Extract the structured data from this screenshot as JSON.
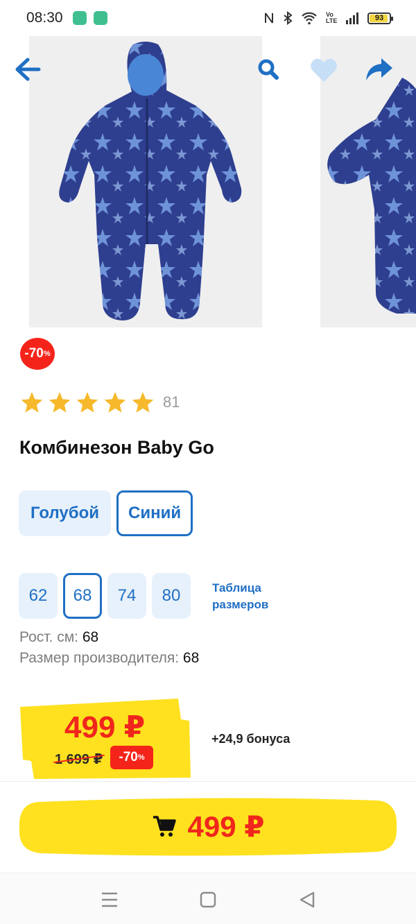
{
  "status_bar": {
    "time": "08:30",
    "battery": "93",
    "network_label": "Vo LTE"
  },
  "product": {
    "discount_badge": {
      "value": "-70",
      "unit": "%"
    },
    "rating_stars": 5,
    "rating_count": "81",
    "title": "Комбинезон Baby Go",
    "colors": [
      "Голубой",
      "Синий"
    ],
    "selected_color": "Синий",
    "sizes": [
      "62",
      "68",
      "74",
      "80"
    ],
    "selected_size": "68",
    "size_table_label": [
      "Таблица",
      "размеров"
    ],
    "height_label": "Рост. см:",
    "height_value": "68",
    "maker_size_label": "Размер производителя:",
    "maker_size_value": "68"
  },
  "price": {
    "current": "499 ₽",
    "old": "1 699 ₽",
    "discount": {
      "value": "-70",
      "unit": "%"
    },
    "bonus": "+24,9 бонуса"
  },
  "cart_button": {
    "price": "499 ₽"
  },
  "colors": {
    "accent_blue": "#1f6fc4",
    "sale_red": "#f0261c",
    "price_yellow": "#ffe11f"
  },
  "icons": [
    "back-arrow-icon",
    "search-icon",
    "heart-icon",
    "share-icon",
    "star-icon",
    "cart-icon",
    "menu-icon",
    "home-square-icon",
    "back-triangle-icon"
  ]
}
